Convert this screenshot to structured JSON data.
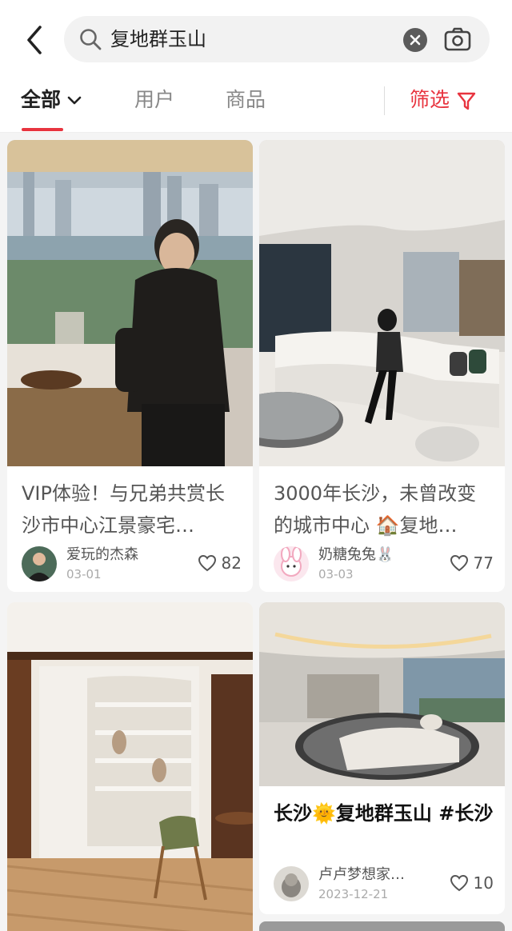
{
  "search": {
    "query": "复地群玉山"
  },
  "tabs": {
    "all": "全部",
    "users": "用户",
    "goods": "商品",
    "filter": "筛选"
  },
  "colors": {
    "accent": "#e8343f",
    "background": "#f4f4f4"
  },
  "posts": [
    {
      "title": "VIP体验！与兄弟共赏长沙市中心江景豪宅…",
      "author": "爱玩的杰森",
      "date": "03-01",
      "likes": "82"
    },
    {
      "title": "3000年长沙，未曾改变的城市中心 🏠复地…",
      "author": "奶糖兔兔🐰",
      "date": "03-03",
      "likes": "77"
    },
    {
      "title": "",
      "author": "",
      "date": "",
      "likes": ""
    },
    {
      "title": "长沙🌞复地群玉山 #长沙",
      "author": "卢卢梦想家…",
      "date": "2023-12-21",
      "likes": "10"
    }
  ]
}
